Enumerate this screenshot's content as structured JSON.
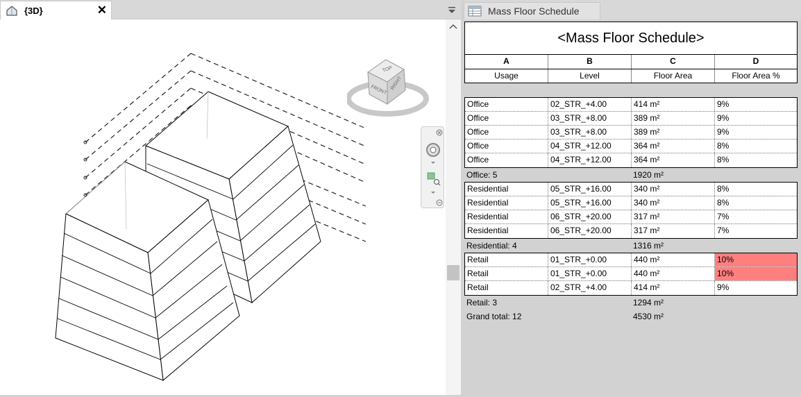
{
  "view_tab": {
    "title": "{3D}"
  },
  "viewcube": {
    "top": "TOP",
    "front": "FRONT",
    "right": "RIGHT"
  },
  "schedule_tab": {
    "title": "Mass Floor Schedule"
  },
  "schedule": {
    "title": "<Mass Floor Schedule>",
    "col_letters": [
      "A",
      "B",
      "C",
      "D"
    ],
    "col_headers": [
      "Usage",
      "Level",
      "Floor Area",
      "Floor Area %"
    ],
    "highlight_color": "#ff7f7f",
    "groups": [
      {
        "rows": [
          [
            "Office",
            "02_STR_+4.00",
            "414 m²",
            "9%"
          ],
          [
            "Office",
            "03_STR_+8.00",
            "389 m²",
            "9%"
          ],
          [
            "Office",
            "03_STR_+8.00",
            "389 m²",
            "9%"
          ],
          [
            "Office",
            "04_STR_+12.00",
            "364 m²",
            "8%"
          ],
          [
            "Office",
            "04_STR_+12.00",
            "364 m²",
            "8%"
          ]
        ],
        "subtotal_label": "Office: 5",
        "subtotal_area": "1920 m²"
      },
      {
        "rows": [
          [
            "Residential",
            "05_STR_+16.00",
            "340 m²",
            "8%"
          ],
          [
            "Residential",
            "05_STR_+16.00",
            "340 m²",
            "8%"
          ],
          [
            "Residential",
            "06_STR_+20.00",
            "317 m²",
            "7%"
          ],
          [
            "Residential",
            "06_STR_+20.00",
            "317 m²",
            "7%"
          ]
        ],
        "subtotal_label": "Residential: 4",
        "subtotal_area": "1316 m²"
      },
      {
        "rows": [
          [
            "Retail",
            "01_STR_+0.00",
            "440 m²",
            "10%"
          ],
          [
            "Retail",
            "01_STR_+0.00",
            "440 m²",
            "10%"
          ],
          [
            "Retail",
            "02_STR_+4.00",
            "414 m²",
            "9%"
          ]
        ],
        "highlighted_rows": [
          0,
          1
        ],
        "subtotal_label": "Retail: 3",
        "subtotal_area": "1294 m²"
      }
    ],
    "grand_total_label": "Grand total: 12",
    "grand_total_area": "4530 m²"
  }
}
